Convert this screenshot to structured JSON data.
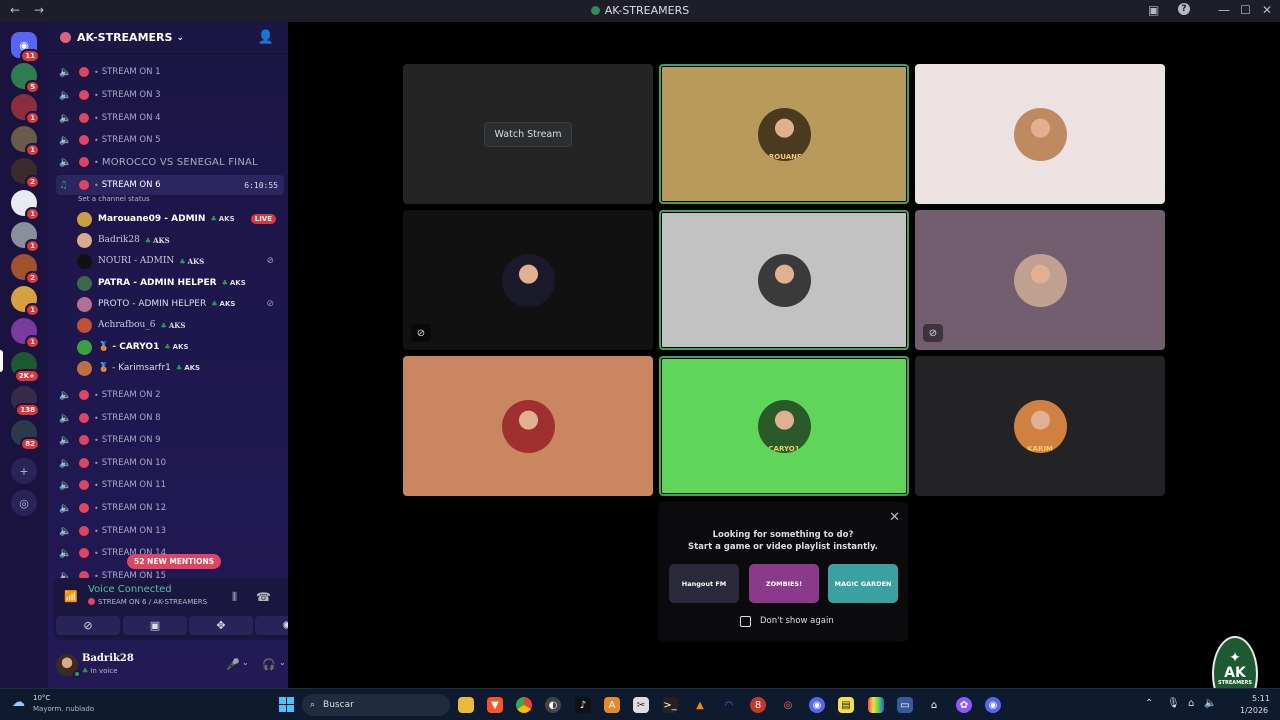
{
  "titlebar": {
    "title": "AK-STREAMERS",
    "back": "←",
    "forward": "→",
    "minimize": "—",
    "maximize": "☐",
    "close": "✕",
    "help": "?"
  },
  "rail": {
    "servers": [
      {
        "badge": "11",
        "color": "#5865f2"
      },
      {
        "badge": "5",
        "color": "#2e7d4f"
      },
      {
        "badge": "1",
        "color": "#8b2d3a"
      },
      {
        "badge": "1",
        "color": "#6b5a4a"
      },
      {
        "badge": "2",
        "color": "#3a2a2a"
      },
      {
        "badge": "1",
        "color": "#e9e9f0"
      },
      {
        "badge": "1",
        "color": "#8a8f99"
      },
      {
        "badge": "2",
        "color": "#a0522d"
      },
      {
        "badge": "1",
        "color": "#d4a040"
      },
      {
        "badge": "1",
        "color": "#7a3aa0"
      },
      {
        "badge": "2K+",
        "color": "#1d5a32"
      },
      {
        "badge": "138",
        "color": "#3a2a4a"
      },
      {
        "badge": "82",
        "color": "#2a3a4a"
      }
    ],
    "add_icon": "+",
    "explore_icon": "◎"
  },
  "guild": {
    "name": "AK-STREAMERS"
  },
  "channels_top": [
    {
      "name": "STREAM ON 1"
    },
    {
      "name": "STREAM ON 3"
    },
    {
      "name": "STREAM ON 4"
    },
    {
      "name": "STREAM ON 5"
    },
    {
      "name": "MOROCCO VS SENEGAL FINAL"
    }
  ],
  "active_channel": {
    "name": "STREAM ON 6",
    "timer": "6:10:55",
    "status_prompt": "Set a channel status"
  },
  "members": [
    {
      "name": "Marouane09 - ADMIN",
      "tag": "AKS",
      "live": "LIVE",
      "color": "#c9a040"
    },
    {
      "name": "Badrik28",
      "tag": "AKS",
      "color": "#d9a98a"
    },
    {
      "name": "NOURI - ADMIN",
      "tag": "AKS",
      "color": "#111111"
    },
    {
      "name": "PATRA - ADMIN HELPER",
      "tag": "AKS",
      "color": "#3a6a4a"
    },
    {
      "name": "PROTO - ADMIN HELPER",
      "tag": "AKS",
      "color": "#b07090"
    },
    {
      "name": "Achrafbou_6",
      "tag": "AKS",
      "color": "#c05030"
    },
    {
      "name": "🥉 - CARYO1",
      "tag": "AKS",
      "color": "#3aa040"
    },
    {
      "name": "🥉 - Karimsarfr1",
      "tag": "AKS",
      "color": "#c07040"
    }
  ],
  "channels_bottom": [
    {
      "name": "STREAM ON 2"
    },
    {
      "name": "STREAM ON 8"
    },
    {
      "name": "STREAM ON 9"
    },
    {
      "name": "STREAM ON 10"
    },
    {
      "name": "STREAM ON 11"
    },
    {
      "name": "STREAM ON 12"
    },
    {
      "name": "STREAM ON 13"
    },
    {
      "name": "STREAM ON 14"
    },
    {
      "name": "STREAM ON 15"
    }
  ],
  "mentions": "52 NEW MENTIONS",
  "voice": {
    "title": "Voice Connected",
    "channel": "STREAM ON 6 / AK-STREAMERS"
  },
  "user": {
    "name": "Badrik28",
    "status": "In voice"
  },
  "stage": {
    "watch_label": "Watch Stream",
    "tiles": [
      {
        "bg": "#242424",
        "type": "watch"
      },
      {
        "bg": "#b89a5a",
        "speaking": true,
        "avatar": "#4a3a20",
        "label": "MAROUANE09"
      },
      {
        "bg": "#ebe2e1",
        "avatar": "#c08a60",
        "label": ""
      },
      {
        "bg": "#111111",
        "avatar": "#1a1a2a",
        "label": "",
        "muted": true
      },
      {
        "bg": "#c2c2c2",
        "speaking": true,
        "avatar": "#3a3a3a",
        "label": ""
      },
      {
        "bg": "#735e6f",
        "avatar": "#c0a090",
        "label": "",
        "muted": true
      },
      {
        "bg": "#c98660",
        "avatar": "#a03030",
        "label": ""
      },
      {
        "bg": "#5fd65a",
        "speaking": true,
        "avatar": "#2a5a2a",
        "label": "CARYO1"
      },
      {
        "bg": "#232326",
        "avatar": "#d08040",
        "label": "KARIM"
      }
    ]
  },
  "activity": {
    "line1": "Looking for something to do?",
    "line2": "Start a game or video playlist instantly.",
    "items": [
      {
        "name": "Hangout FM",
        "color": "#2a2a3a"
      },
      {
        "name": "ZOMBIES!",
        "color": "#8a3a8a"
      },
      {
        "name": "MAGIC GARDEN",
        "color": "#3aa0a0"
      }
    ],
    "checkbox_label": "Don't show again"
  },
  "logo": {
    "text": "AK",
    "sub": "STREAMERS"
  },
  "taskbar": {
    "weather_temp": "10°C",
    "weather_desc": "Mayorm. nublado",
    "search_placeholder": "Buscar",
    "time": "5:11",
    "date": "1/2026"
  }
}
